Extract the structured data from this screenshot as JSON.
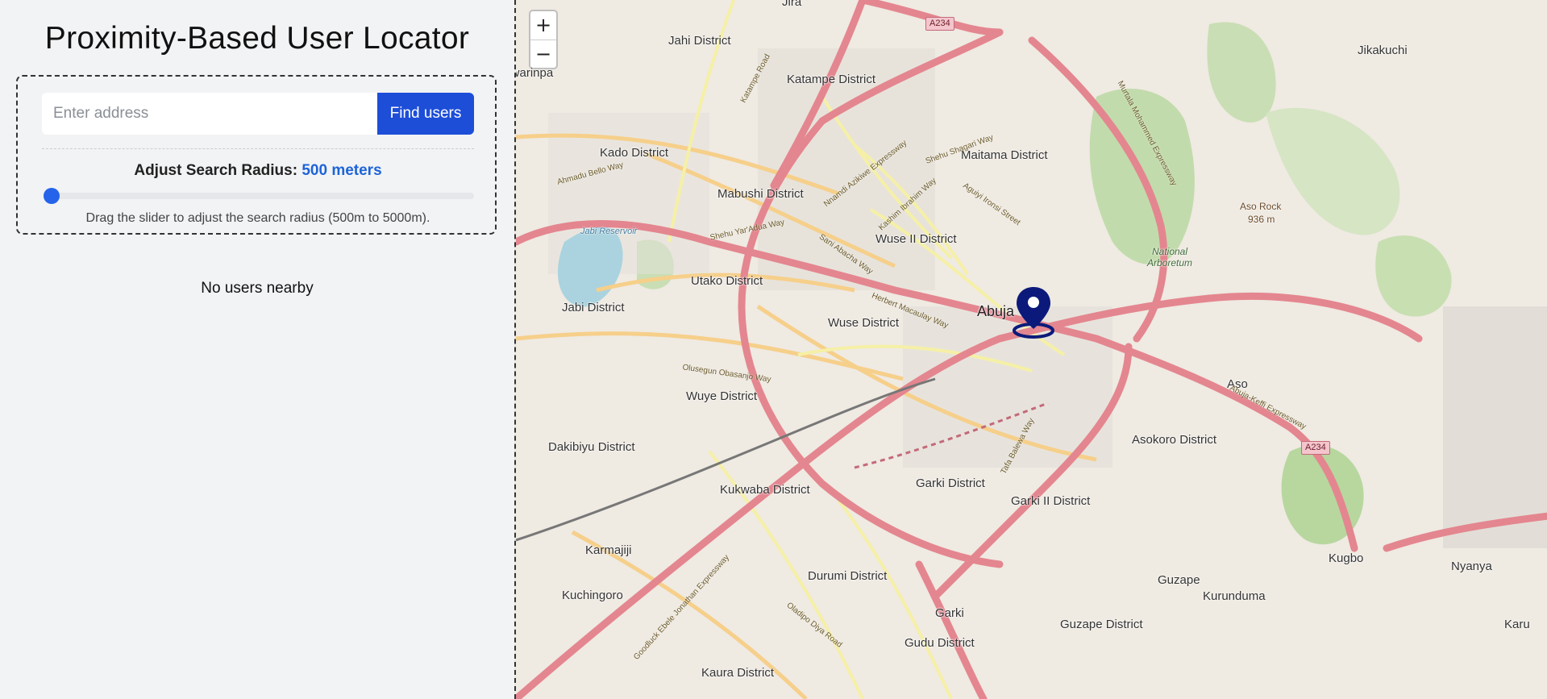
{
  "header": {
    "title": "Proximity-Based User Locator"
  },
  "search": {
    "placeholder": "Enter address",
    "button_label": "Find users"
  },
  "radius": {
    "label": "Adjust Search Radius:",
    "value_text": "500 meters",
    "value_m": 500,
    "min_m": 500,
    "max_m": 5000,
    "help": "Drag the slider to adjust the search radius (500m to 5000m)."
  },
  "results": {
    "empty_text": "No users nearby"
  },
  "map": {
    "zoom_in": "+",
    "zoom_out": "−",
    "center_label": "Abuja",
    "districts": [
      "Jahi District",
      "Katampe District",
      "Kado District",
      "Mabushi District",
      "Maitama District",
      "Wuse II District",
      "Utako District",
      "Jabi District",
      "Wuse District",
      "Wuye District",
      "Dakibiyu District",
      "Kukwaba District",
      "Garki District",
      "Garki II District",
      "Asokoro District",
      "Karmajiji",
      "Kuchingoro",
      "Durumi District",
      "Garki",
      "Gudu District",
      "Guzape District",
      "Guzape",
      "Kurunduma",
      "Kaura District",
      "Jikakuchi",
      "Aso Rock",
      "936 m",
      "National Arboretum",
      "Aso",
      "Kugbo",
      "Nyanya",
      "Karu",
      "Jabi Reservoir",
      "Jira",
      "Gwarinpa"
    ],
    "road_names": [
      "Katampe Road",
      "Ahmadu Bello Way",
      "Shehu Yar'Adua Way",
      "Nnamdi Azikiwe Expressway",
      "Shehu Shagari Way",
      "Kashim Ibrahim Way",
      "Aguiyi Ironsi Street",
      "Sani Abacha Way",
      "Herbert Macaulay Way",
      "Olusegun Obasanjo Way",
      "Murtala Mohammed Expressway",
      "Abuja-Keffi Expressway",
      "Goodluck Ebele Jonathan Expressway",
      "Oladipo Diya Road",
      "Tafa Balewa Way"
    ],
    "shields": [
      "A234",
      "A234"
    ],
    "colors": {
      "background": "#efeae2",
      "major_road": "#e4868f",
      "secondary_road": "#f6cf8a",
      "tertiary_road": "#f5f0a6",
      "park": "#bcd9a6",
      "water": "#aad3df",
      "marker": "#0b1a7a"
    }
  }
}
